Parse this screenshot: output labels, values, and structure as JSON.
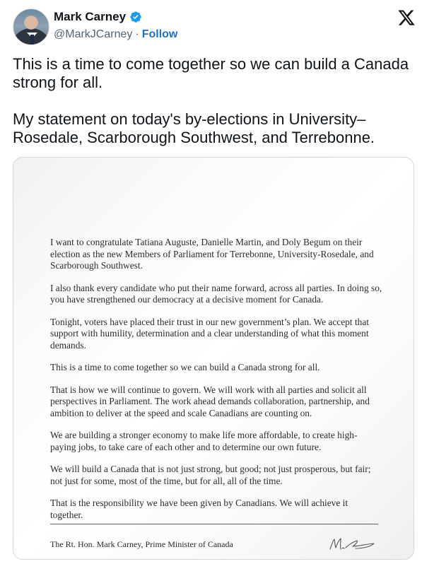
{
  "author": {
    "name": "Mark Carney",
    "handle": "@MarkJCarney",
    "separator": "·",
    "follow_label": "Follow"
  },
  "icons": {
    "verified": "verified-badge-icon",
    "platform": "x-logo-icon"
  },
  "colors": {
    "accent": "#1d6fd0",
    "verified": "#1d9bf0",
    "text": "#0f1419",
    "muted": "#536471"
  },
  "tweet": {
    "paragraphs": [
      "This is a time to come together so we can build a Canada strong for all.",
      "My statement on today's by-elections in University–Rosedale, Scarborough Southwest, and Terrebonne."
    ]
  },
  "statement": {
    "paragraphs": [
      "I want to congratulate Tatiana Auguste, Danielle Martin, and Doly Begum on their election as the new Members of Parliament for Terrebonne, University-Rosedale, and Scarborough Southwest.",
      "I also thank every candidate who put their name forward, across all parties. In doing so, you have strengthened our democracy at a decisive moment for Canada.",
      "Tonight, voters have placed their trust in our new government’s plan. We accept that support with humility, determination and a clear understanding of what this moment demands.",
      "This is a time to come together so we can build a Canada strong for all.",
      "That is how we will continue to govern. We will work with all parties and solicit all perspectives in Parliament. The work ahead demands collaboration, partnership, and ambition to deliver at the speed and scale Canadians are counting on.",
      "We are building a stronger economy to make life more affordable, to create high-paying jobs, to take care of each other and to determine our own future.",
      "We will build a Canada that is not just strong, but good; not just prosperous, but fair; not just for some, most of the time, but for all, all of the time.",
      "That is the responsibility we have been given by Canadians. We will achieve it together."
    ],
    "signoff": "The Rt. Hon. Mark Carney, Prime Minister of Canada"
  }
}
